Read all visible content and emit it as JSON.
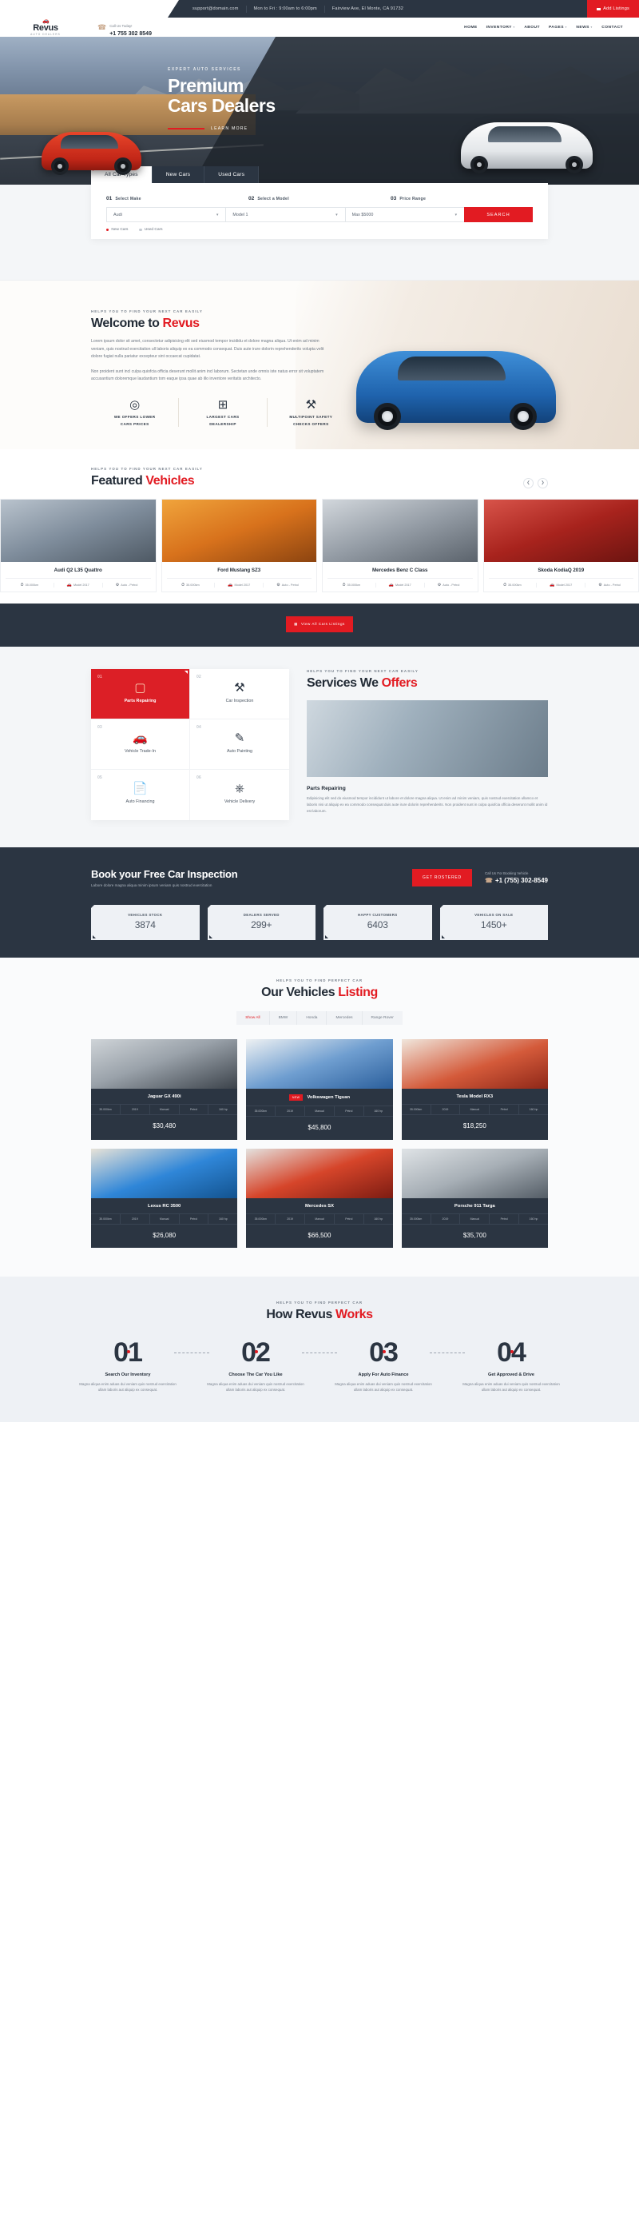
{
  "topbar": {
    "items": [
      "support@domain.com",
      "Mon to Fri : 9:00am to 6:00pm",
      "Fairview Ave, El Monte, CA 91732"
    ],
    "cta": "Add Listings"
  },
  "header": {
    "logo_name": "Revus",
    "logo_sub": "AUTO DEALERS",
    "phone_label": "Call Us Today!",
    "phone_number": "+1 755 302 8549",
    "nav": [
      "HOME",
      "INVENTORY",
      "ABOUT",
      "PAGES",
      "NEWS",
      "CONTACT"
    ]
  },
  "hero": {
    "eyebrow": "EXPERT AUTO SERVICES",
    "title_line1": "Premium",
    "title_line2": "Cars Dealers",
    "learn_more": "LEARN MORE"
  },
  "search": {
    "tabs": [
      "All Car Types",
      "New Cars",
      "Used Cars"
    ],
    "active_tab": "All Car Types",
    "fields": [
      {
        "num": "01",
        "label": "Select Make",
        "value": "Audi"
      },
      {
        "num": "02",
        "label": "Select a Model",
        "value": "Model 1"
      },
      {
        "num": "03",
        "label": "Price Range",
        "value": "Max $5000"
      }
    ],
    "button": "SEARCH",
    "radios": [
      "New Cars",
      "Used Cars"
    ]
  },
  "welcome": {
    "eyebrow": "HELPS YOU TO FIND YOUR NEXT CAR EASILY",
    "title": "Welcome to ",
    "title_red": "Revus",
    "para1": "Lorem ipsum dolor sit amet, consectetur adipisicing elit sed eiusmod tempor incididu et dolore magna aliqua. Ut enim ad minim veniam, quis nostrud exercitation ull laboris aliquip ex ea commodo consequat. Duis aute irure dolorin reprehenderits volupta velit dolore fugiat nulla pariatur excepteur sint occaecat cupidatat.",
    "para2": "Non proident sunt incl culpa quiofcia officia deserunt mollit anim incl laborum. Sectetan unde omnis iste natus error sit voluptatem accusantium doloremque laudantium tom eaque ipsa quae ab illo inventore veritatis architecto.",
    "features": [
      {
        "icon": "steering-wheel-icon",
        "glyph": "◎",
        "title": "WE OFFERS LOWER",
        "title2": "CARS PRICES"
      },
      {
        "icon": "gear-shift-icon",
        "glyph": "⊞",
        "title": "LARGEST CARS",
        "title2": "DEALERSHIP"
      },
      {
        "icon": "tools-icon",
        "glyph": "⚒",
        "title": "MULTIPOINT SAFETY",
        "title2": "CHECKS OFFERS"
      }
    ]
  },
  "featured": {
    "eyebrow": "HELPS YOU TO FIND YOUR NEXT CAR EASILY",
    "title": "Featured ",
    "title_red": "Vehicles",
    "cards": [
      {
        "name": "Audi Q2 L35 Quattro",
        "km": "35.000km",
        "model": "Model 2017",
        "fuel": "Auto - Petrol",
        "img": "silver"
      },
      {
        "name": "Ford Mustang SZ3",
        "km": "35.000km",
        "model": "Model 2017",
        "fuel": "Auto - Petrol",
        "img": "orange"
      },
      {
        "name": "Mercedes Benz C Class",
        "km": "35.000km",
        "model": "Model 2017",
        "fuel": "Auto - Petrol",
        "img": "grey"
      },
      {
        "name": "Skoda KodiaQ 2019",
        "km": "35.000km",
        "model": "Model 2017",
        "fuel": "Auto - Petrol",
        "img": "red"
      }
    ],
    "all_button": "View All Cars Listings"
  },
  "services": {
    "eyebrow": "HELPS YOU TO FIND YOUR NEXT CAR EASILY",
    "title": "Services We ",
    "title_red": "Offers",
    "cells": [
      {
        "num": "01",
        "glyph": "◰",
        "name": "Parts Repairing",
        "active": true
      },
      {
        "num": "02",
        "glyph": "⚒",
        "name": "Car Inspection",
        "active": false
      },
      {
        "num": "03",
        "glyph": "Ὡ7",
        "name": "Vehicle Trade-In",
        "active": false
      },
      {
        "num": "04",
        "glyph": "✐",
        "name": "Auto Painting",
        "active": false
      },
      {
        "num": "05",
        "glyph": "Ὃ5",
        "name": "Auto Financing",
        "active": false
      },
      {
        "num": "06",
        "glyph": "⛍",
        "name": "Vehicle Delivery",
        "active": false
      }
    ],
    "detail_title": "Parts Repairing",
    "detail_text": "Edipisicing elit sed do eiusmod tempor incididunt ut labore et dolore magna aliqua. Ut enim ad minim veniam, quis nostrud exercitation ullamco et laboris nisi ut aliquip ex ea commodo consequat duis aute irure dolorin reprehenderits. Non proident sunt in culpa quiofcia officia deserunt mollit anim id est laborum."
  },
  "booking": {
    "title": "Book your Free Car Inspection",
    "sub": "Labore dolore magna aliqua minim ipsum veniam quis nostrud exercitation",
    "button": "GET ROSTERED",
    "call_label": "Call Us For Booking Vehicle",
    "call_number": "+1 (755) 302-8549",
    "stats": [
      {
        "label": "VEHICLES STOCK",
        "value": "3874"
      },
      {
        "label": "DEALERS SERVED",
        "value": "299+"
      },
      {
        "label": "HAPPY CUSTOMERS",
        "value": "6403"
      },
      {
        "label": "VEHICLES ON SALE",
        "value": "1450+"
      }
    ]
  },
  "listing": {
    "eyebrow": "HELPS YOU TO FIND PERFECT CAR",
    "title": "Our Vehicles ",
    "title_red": "Listing",
    "filters": [
      "Show All",
      "BMW",
      "Honda",
      "Mercedes",
      "Range Rover"
    ],
    "active_filter": "Show All",
    "cards": [
      {
        "name": "Jaguar GX 490i",
        "badge": "",
        "price": "$30,480",
        "specs": [
          "35.000km",
          "2019",
          "Manual",
          "Petrol",
          "160 hp"
        ],
        "img": "dark"
      },
      {
        "name": "Volkswagen Tiguan",
        "badge": "NEW",
        "price": "$45,800",
        "specs": [
          "35.000km",
          "2019",
          "Manual",
          "Petrol",
          "160 hp"
        ],
        "img": "white"
      },
      {
        "name": "Tesla Model RX3",
        "badge": "",
        "price": "$18,250",
        "specs": [
          "35.000km",
          "2019",
          "Manual",
          "Petrol",
          "160 hp"
        ],
        "img": "red"
      },
      {
        "name": "Lexus RC 3500",
        "badge": "",
        "price": "$26,080",
        "specs": [
          "35.000km",
          "2019",
          "Manual",
          "Petrol",
          "160 hp"
        ],
        "img": "blue"
      },
      {
        "name": "Mercedes SX",
        "badge": "",
        "price": "$66,500",
        "specs": [
          "35.000km",
          "2019",
          "Manual",
          "Petrol",
          "160 hp"
        ],
        "img": "red2"
      },
      {
        "name": "Porsche 911 Targa",
        "badge": "",
        "price": "$35,700",
        "specs": [
          "35.000km",
          "2019",
          "Manual",
          "Petrol",
          "160 hp"
        ],
        "img": "silver"
      }
    ]
  },
  "howworks": {
    "eyebrow": "HELPS YOU TO FIND PERFECT CAR",
    "title": "How Revus ",
    "title_red": "Works",
    "steps": [
      {
        "num": "01",
        "title": "Search Our Inventory",
        "text": "Magna aliqua enim aduas dui veniam quis nostrud exercitation ullam laboris aut aliquip ex consequat."
      },
      {
        "num": "02",
        "title": "Choose The Car You Like",
        "text": "Magna aliqua enim aduas dui veniam quis nostrud exercitation ullam laboris aut aliquip ex consequat."
      },
      {
        "num": "03",
        "title": "Apply For Auto Finance",
        "text": "Magna aliqua enim aduas dui veniam quis nostrud exercitation ullam laboris aut aliquip ex consequat."
      },
      {
        "num": "04",
        "title": "Get Approved & Drive",
        "text": "Magna aliqua enim aduas dui veniam quis nostrud exercitation ullam laboris aut aliquip ex consequat."
      }
    ]
  },
  "colors": {
    "accent": "#e21b22",
    "dark": "#2b3542",
    "light": "#f4f6f8"
  }
}
